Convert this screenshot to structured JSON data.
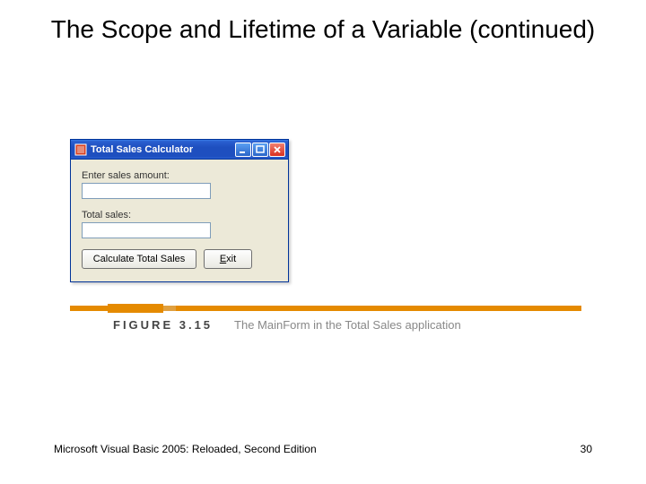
{
  "title": "The Scope and Lifetime of a Variable (continued)",
  "window": {
    "title": "Total Sales Calculator",
    "label_amount": "Enter sales amount:",
    "label_total": "Total sales:",
    "input_amount": "",
    "input_total": "",
    "btn_calc": "Calculate Total Sales",
    "btn_exit": "Exit"
  },
  "caption": {
    "label": "FIGURE 3.15",
    "text": "The MainForm in the Total Sales application"
  },
  "footer": {
    "left": "Microsoft Visual Basic 2005: Reloaded, Second Edition",
    "right": "30"
  }
}
